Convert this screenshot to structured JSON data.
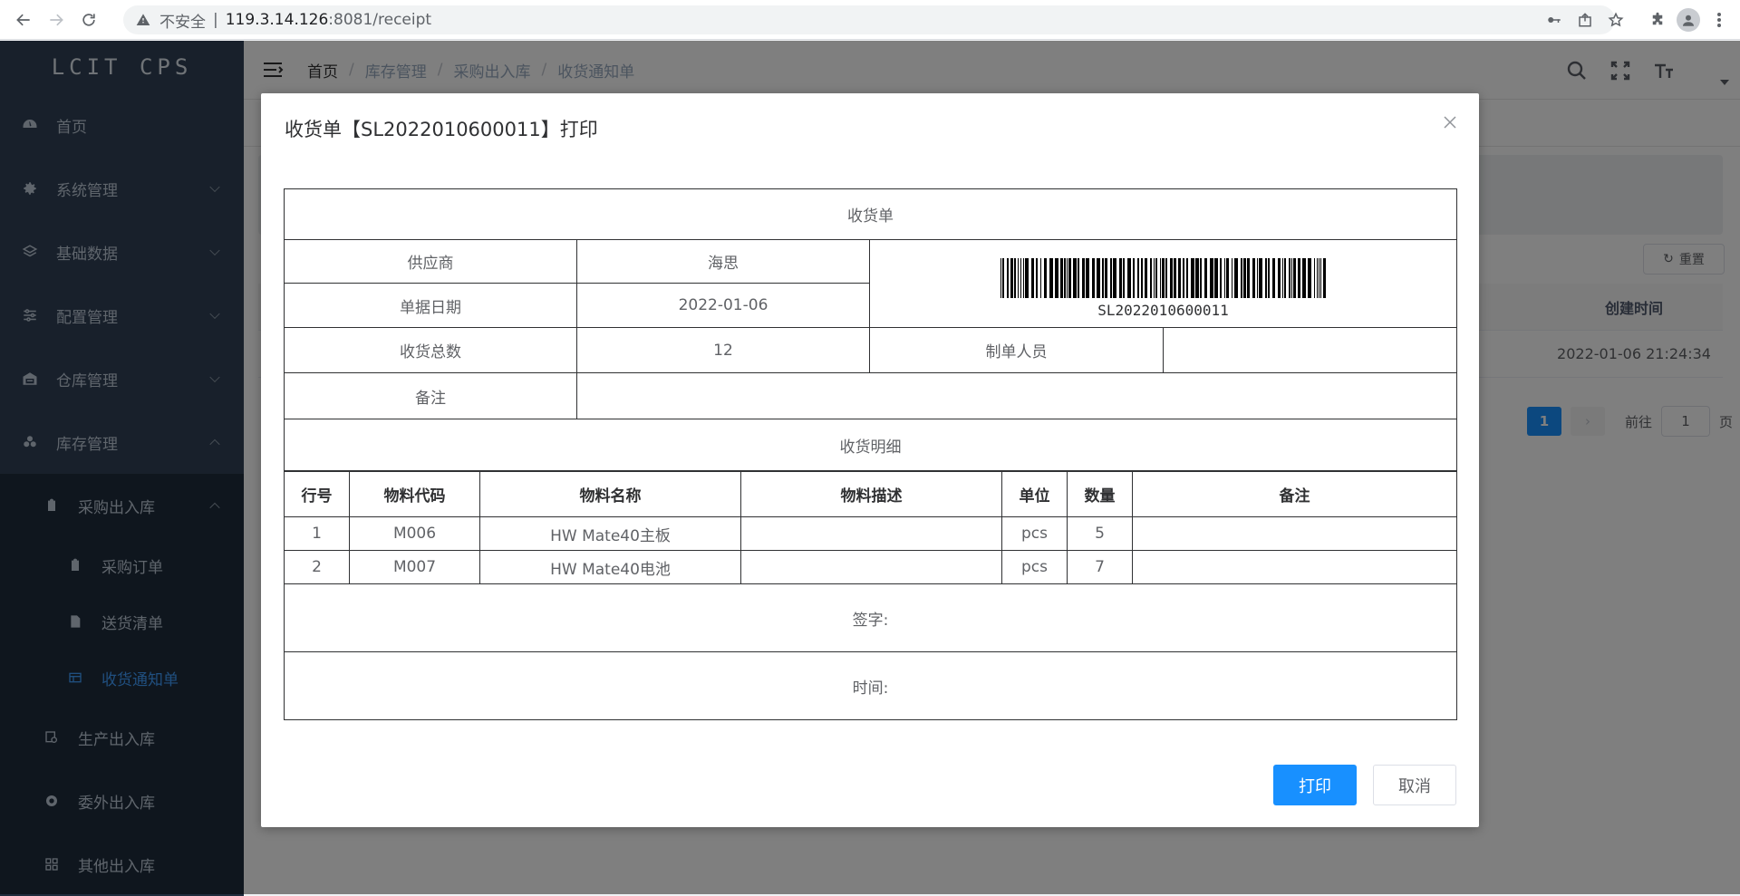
{
  "browser": {
    "insecure_label": "不安全",
    "separator": "|",
    "url_host": "119.3.14.126",
    "url_path": ":8081/receipt"
  },
  "sidebar": {
    "logo": "LCIT CPS",
    "items": [
      {
        "label": "首页",
        "icon": "dashboard-icon"
      },
      {
        "label": "系统管理",
        "icon": "gear-icon"
      },
      {
        "label": "基础数据",
        "icon": "layers-icon"
      },
      {
        "label": "配置管理",
        "icon": "sliders-icon"
      },
      {
        "label": "仓库管理",
        "icon": "warehouse-icon"
      },
      {
        "label": "库存管理",
        "icon": "boxes-icon"
      }
    ],
    "sub_group": {
      "label": "采购出入库",
      "icon": "clipboard-icon"
    },
    "sub_items": [
      {
        "label": "采购订单",
        "icon": "clipboard-icon"
      },
      {
        "label": "送货清单",
        "icon": "document-icon"
      },
      {
        "label": "收货通知单",
        "icon": "table-icon"
      }
    ],
    "after_items": [
      {
        "label": "生产出入库",
        "icon": "production-icon"
      },
      {
        "label": "委外出入库",
        "icon": "outsource-icon"
      },
      {
        "label": "其他出入库",
        "icon": "grid-icon"
      }
    ]
  },
  "breadcrumb": [
    "首页",
    "库存管理",
    "采购出入库",
    "收货通知单"
  ],
  "background_page": {
    "reset_label": "重置",
    "column_header": "创建时间",
    "created_time": "2022-01-06 21:24:34",
    "current_page": "1",
    "goto_label": "前往",
    "goto_value": "1",
    "page_suffix": "页"
  },
  "dialog": {
    "title": "收货单【SL2022010600011】打印",
    "receipt": {
      "title": "收货单",
      "supplier_label": "供应商",
      "supplier_value": "海思",
      "date_label": "单据日期",
      "date_value": "2022-01-06",
      "barcode_text": "SL2022010600011",
      "total_label": "收货总数",
      "total_value": "12",
      "maker_label": "制单人员",
      "maker_value": "",
      "remark_label": "备注",
      "remark_value": "",
      "detail_title": "收货明细",
      "columns": [
        "行号",
        "物料代码",
        "物料名称",
        "物料描述",
        "单位",
        "数量",
        "备注"
      ],
      "rows": [
        [
          "1",
          "M006",
          "HW Mate40主板",
          "",
          "pcs",
          "5",
          ""
        ],
        [
          "2",
          "M007",
          "HW Mate40电池",
          "",
          "pcs",
          "7",
          ""
        ]
      ],
      "sign_label": "签字:",
      "time_label": "时间:"
    },
    "print_label": "打印",
    "cancel_label": "取消"
  }
}
